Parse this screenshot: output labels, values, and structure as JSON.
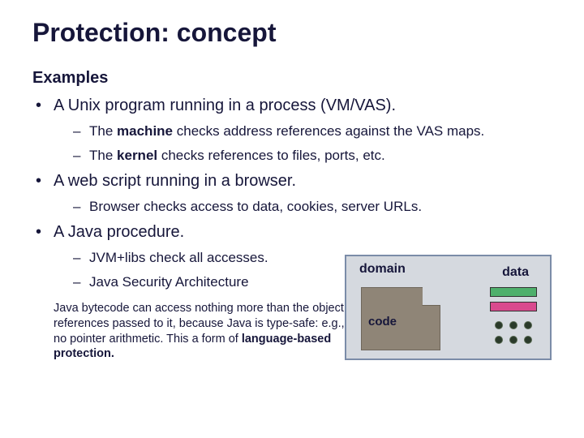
{
  "title": "Protection: concept",
  "subtitle": "Examples",
  "bullet1": {
    "text": "A Unix program running in a process (VM/VAS).",
    "sub1_pre": "The ",
    "sub1_bold": "machine",
    "sub1_post": " checks address references against the VAS maps.",
    "sub2_pre": "The ",
    "sub2_bold": "kernel",
    "sub2_post": " checks references to files, ports, etc."
  },
  "bullet2": {
    "text": "A web script running in a browser.",
    "sub1": "Browser checks access to data, cookies, server URLs."
  },
  "bullet3": {
    "text": "A Java procedure.",
    "sub1": "JVM+libs check all accesses.",
    "sub2": "Java Security Architecture"
  },
  "note_pre": "Java bytecode can access nothing more than the object references passed to it, because Java is type-safe: e.g., no pointer arithmetic. This a form of ",
  "note_bold": "language-based protection.",
  "diagram": {
    "domain": "domain",
    "data": "data",
    "code": "code"
  }
}
